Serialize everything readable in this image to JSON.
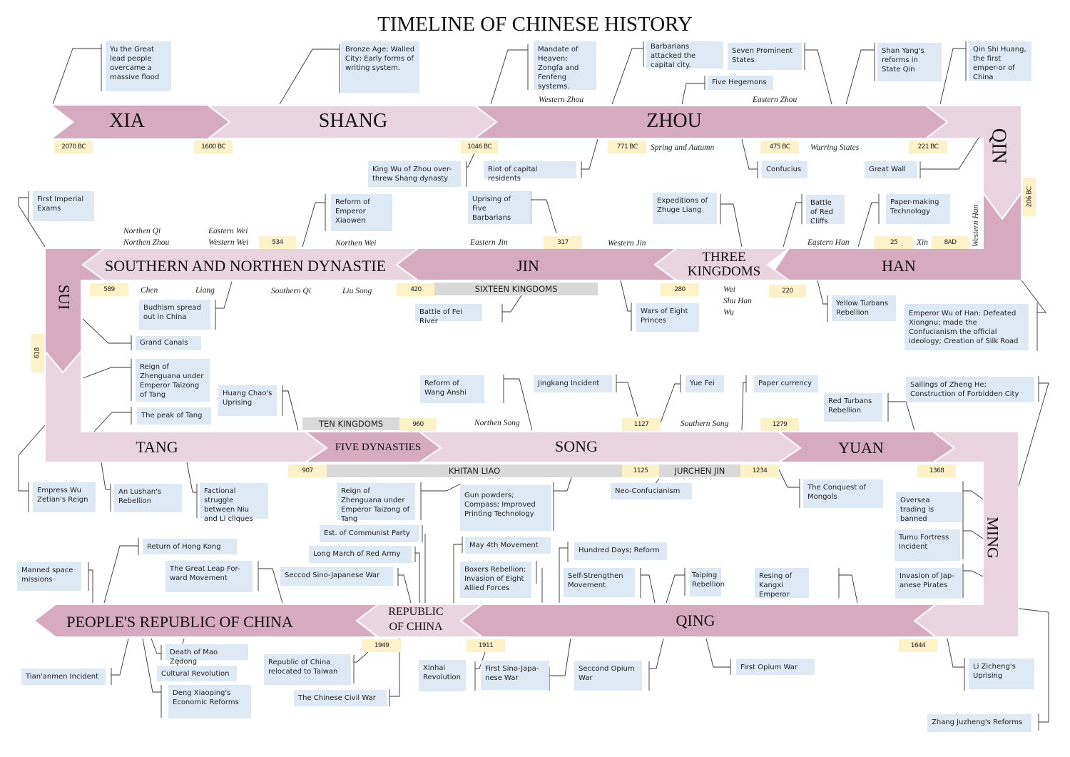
{
  "title": "TIMELINE OF CHINESE HISTORY",
  "colors": {
    "dark_band": "#d6abbf",
    "light_band": "#e9d4df",
    "event_box": "#dde9f5",
    "date_tag": "#fdf1c7",
    "gray_band": "#d9d9d9"
  },
  "dynasties": {
    "xia": "XIA",
    "shang": "SHANG",
    "zhou": "ZHOU",
    "qin": "QIN",
    "han": "HAN",
    "three_kingdoms_1": "THREE",
    "three_kingdoms_2": "KINGDOMS",
    "jin": "JIN",
    "snd": "SOUTHERN AND NORTHEN DYNASTIE",
    "sui": "SUI",
    "tang": "TANG",
    "five_dynasties": "FIVE DYNASTIES",
    "song": "SONG",
    "yuan": "YUAN",
    "ming": "MING",
    "qing": "QING",
    "roc_1": "REPUBLIC",
    "roc_2": "OF CHINA",
    "prc": "PEOPLE'S REPUBLIC OF CHINA"
  },
  "dates": {
    "d2070": "2070 BC",
    "d1600": "1600 BC",
    "d1046": "1046 BC",
    "d771": "771 BC",
    "d475": "475 BC",
    "d221": "221 BC",
    "d206": "206 BC",
    "d8": "8AD",
    "d25": "25",
    "d220": "220",
    "d280": "280",
    "d317": "317",
    "d420": "420",
    "d534": "534",
    "d589": "589",
    "d618": "618",
    "d907": "907",
    "d960": "960",
    "d1125": "1125",
    "d1127": "1127",
    "d1234": "1234",
    "d1279": "1279",
    "d1368": "1368",
    "d1644": "1644",
    "d1911": "1911",
    "d1949": "1949"
  },
  "sub_periods": {
    "western_zhou": "Western Zhou",
    "eastern_zhou": "Eastern Zhou",
    "spring_autumn": "Spring and Autumn",
    "warring_states": "Warring States",
    "western_han": "Western Han",
    "eastern_han": "Eastern Han",
    "xin": "Xin",
    "wei": "Wei",
    "shu_han": "Shu Han",
    "wu": "Wu",
    "western_jin": "Western Jin",
    "eastern_jin": "Eastern Jin",
    "northen_wei": "Northen Wei",
    "eastern_wei": "Eastern Wei",
    "western_wei": "Western Wei",
    "northen_qi": "Northen Qi",
    "northen_zhou": "Northen Zhou",
    "chen": "Chen",
    "liang": "Liang",
    "southern_qi": "Southern Qi",
    "liu_song": "Liu Song",
    "northen_song": "Northen Song",
    "southern_song": "Southern Song"
  },
  "parallel_states": {
    "sixteen_kingdoms": "SIXTEEN KINGDOMS",
    "ten_kingdoms": "TEN KINGDOMS",
    "khitan_liao": "KHITAN LIAO",
    "jurchen_jin": "JURCHEN JIN"
  },
  "events": [
    "Yu the Great lead people overcame a massive flood",
    "Bronze Age; Walled City; Early forms of writing system.",
    "Mandate of Heaven; Zongfa and Fenfeng systems.",
    "Barbarians attacked the capital city.",
    "Seven Prominent States",
    "Five Hegemons",
    "Shan Yang's reforms in State Qin",
    "Qin Shi Huang, the first emper-or of China",
    "King Wu of Zhou over-threw Shang dynasty",
    "Riot of capital residents",
    "Confucius",
    "Great Wall",
    "First Imperial Exams",
    "Reform of Emperor Xiaowen",
    "Uprising of Five Barbarians",
    "Expeditions of Zhuge Liang",
    "Battle of Red Cliffs",
    "Paper-making Technology",
    "Budhism spread out in China",
    "Battle of Fei River",
    "Wars  of Eight Princes",
    "Yellow Turbans Rebellion",
    "Emperor Wu of Han: Defeated Xiongnu; made the Confucianism the official ideology; Creation of Silk Road",
    "Grand Canals",
    "Reign of Zhenguana under Emperor Taizong of Tang",
    "Huang Chao's Uprising",
    "The peak of Tang",
    "Reform of Wang Anshi",
    "Jingkang Incident",
    "Yue Fei",
    "Paper currency",
    "Red Turbans Rebellion",
    "Sailings of Zheng He; Construction of Forbidden City",
    "Empress Wu Zetian's Reign",
    "An Lushan's Rebellion",
    "Factional struggle between Niu and Li cliques",
    "Reign of Zhenguana under Emperor Taizong of Tang",
    "Gun powders; Compass; Improved Printing Technology",
    "Neo-Confucianism",
    "The Conquest of Mongols",
    "Oversea trading is banned",
    "Tumu Fortress Incident",
    "Invasion of Jap-anese Pirates",
    "Est. of Communist Party",
    "Long March of Red Army",
    "Seccod Sino-Japanese War",
    "May 4th Movement",
    "Boxers Rebellion; Invasion of Eight Allied Forces",
    "Hundred Days; Reform",
    "Self-Strengthen Movement",
    "Taiping Rebellion",
    "Resing of Kangxi Emperor",
    "Return of Hong Kong",
    "Manned space missions",
    "The Great Leap For-ward Movement",
    "Death of Mao Zedong",
    "Cultural Revolution",
    "Tian'anmen Incident",
    "Deng Xiaoping's Economic Reforms",
    "Republic of China relocated to Taiwan",
    "The Chinese Civil War",
    "Xinhai Revolution",
    "First Sino-Japa-nese War",
    "Seccond Opium War",
    "First Opium War",
    "Li Zicheng's Uprising",
    "Zhang Juzheng's Reforms"
  ]
}
